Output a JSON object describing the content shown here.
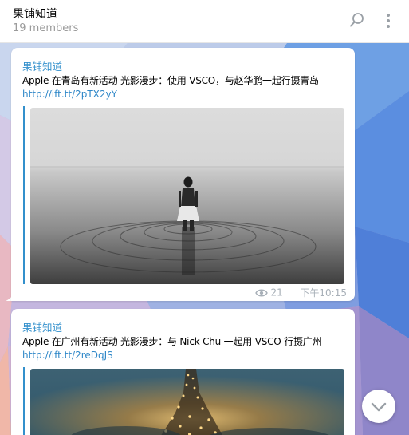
{
  "header": {
    "title": "果铺知道",
    "subtitle": "19 members",
    "search_icon": "search-icon",
    "more_icon": "more-vertical-icon"
  },
  "messages": [
    {
      "sender": "果铺知道",
      "text": "Apple 在青岛有新活动 光影漫步：使用 VSCO，与赵华鹏一起行摄青岛",
      "link": "http://ift.tt/2pTX2yY",
      "views": "21",
      "time": "下午10:15",
      "image": "woman-standing-in-water-photo"
    },
    {
      "sender": "果铺知道",
      "text": "Apple 在广州有新活动 光影漫步：与 Nick Chu 一起用 VSCO 行摄广州",
      "link": "http://ift.tt/2reDqJS",
      "image": "illuminated-tower-photo"
    }
  ],
  "scroll_down_icon": "chevron-down-icon",
  "colors": {
    "accent": "#3390cc",
    "link": "#2e87c8",
    "meta": "#a8b0b8"
  }
}
